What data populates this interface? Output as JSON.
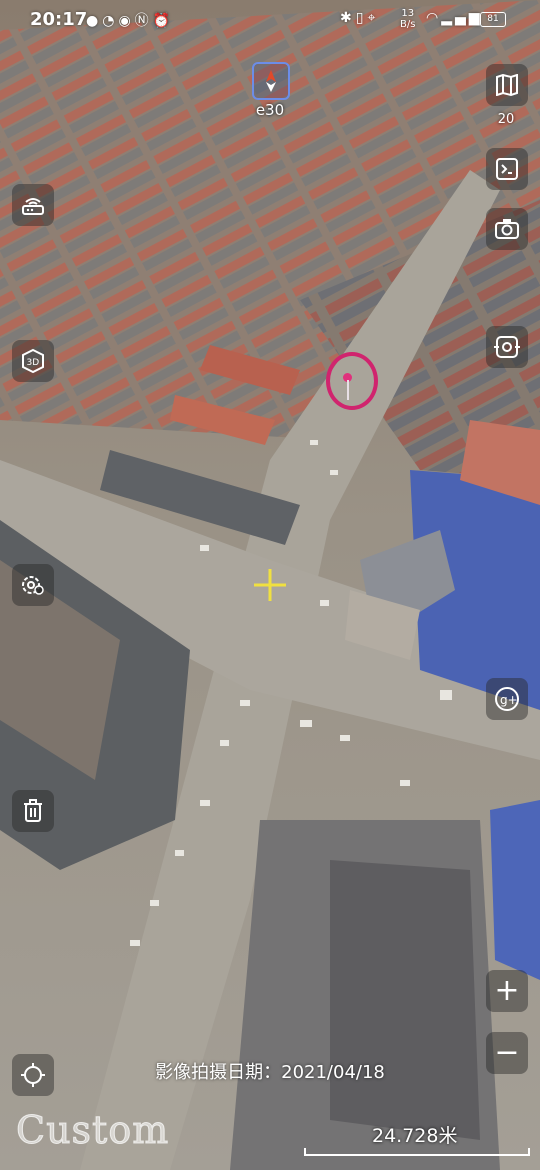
{
  "status_bar": {
    "time": "20:17",
    "left_icons": [
      "wechat-icon",
      "alipay-icon",
      "eye-icon",
      "nfc-icon",
      "alarm-icon"
    ],
    "network_speed_value": "13",
    "network_speed_unit": "B/s",
    "battery": "81"
  },
  "compass": {
    "label": "e30"
  },
  "zoom_level": "20",
  "map": {
    "capture_date_text": "影像拍摄日期：2021/04/18",
    "scale_text": "24.728米",
    "watermark": "Custom"
  },
  "icons": {
    "layers": "map-layers-icon",
    "measure": "measure-icon",
    "camera": "camera-icon",
    "screenshot": "screen-capture-icon",
    "wifi_panel": "router-icon",
    "view_3d": "3d-view-icon",
    "settings_location": "settings-location-icon",
    "delete": "trash-icon",
    "google_plus": "google-plus-icon",
    "zoom_in": "plus-icon",
    "zoom_out": "minus-icon",
    "locate": "locate-icon"
  },
  "colors": {
    "pin": "#d0246e",
    "crosshair": "#f0e040",
    "compass_border": "#6c8de8"
  }
}
